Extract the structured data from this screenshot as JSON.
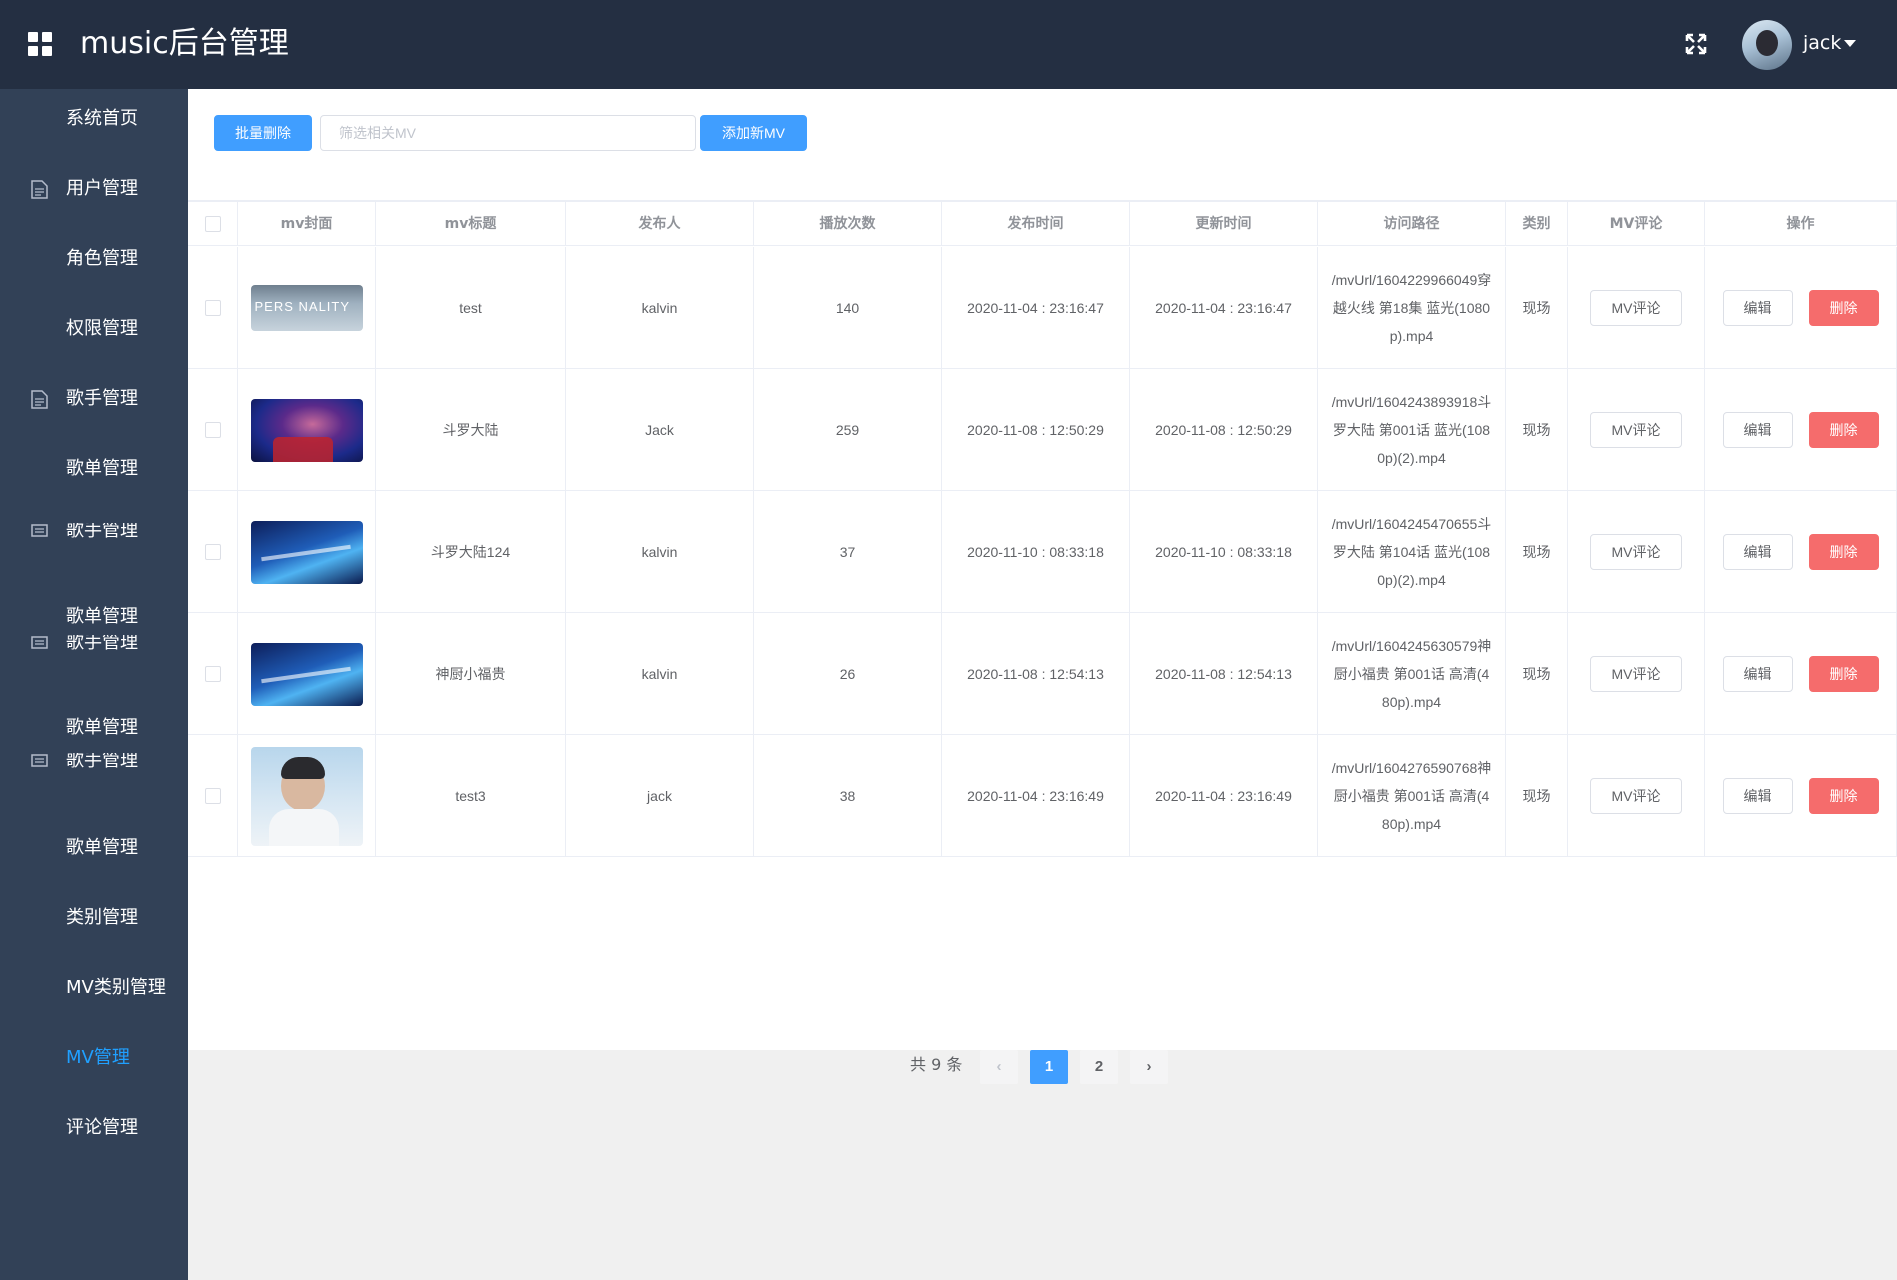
{
  "header": {
    "title": "music后台管理",
    "username": "jack"
  },
  "sidebar": {
    "items": [
      {
        "label": "系统首页",
        "icon": "none"
      },
      {
        "label": "用户管理",
        "icon": "document-icon"
      },
      {
        "label": "角色管理",
        "icon": "none"
      },
      {
        "label": "权限管理",
        "icon": "none"
      },
      {
        "label": "歌手管理",
        "icon": "document-icon"
      },
      {
        "label": "歌单管理",
        "icon": "none"
      },
      {
        "label": "歌手管理",
        "icon": "list-icon"
      },
      {
        "label": "歌单管理",
        "icon": "none"
      },
      {
        "label": "歌手管理",
        "icon": "list-icon"
      },
      {
        "label": "歌单管理",
        "icon": "none"
      },
      {
        "label": "歌手管理",
        "icon": "list-icon"
      },
      {
        "label": "歌单管理",
        "icon": "none"
      },
      {
        "label": "类别管理",
        "icon": "none"
      },
      {
        "label": "MV类别管理",
        "icon": "none"
      },
      {
        "label": "MV管理",
        "icon": "none",
        "active": true
      },
      {
        "label": "评论管理",
        "icon": "none"
      }
    ]
  },
  "toolbar": {
    "batch_delete": "批量删除",
    "search_placeholder": "筛选相关MV",
    "add_mv": "添加新MV"
  },
  "table": {
    "headers": [
      "mv封面",
      "mv标题",
      "发布人",
      "播放次数",
      "发布时间",
      "更新时间",
      "访问路径",
      "类别",
      "MV评论",
      "操作"
    ],
    "rows": [
      {
        "title": "test",
        "publisher": "kalvin",
        "plays": "140",
        "published": "2020-11-04 : 23:16:47",
        "updated": "2020-11-04 : 23:16:47",
        "path": "/mvUrl/1604229966049穿越火线 第18集 蓝光(1080p).mp4",
        "category": "现场",
        "cover_text": "PERS NALITY"
      },
      {
        "title": "斗罗大陆",
        "publisher": "Jack",
        "plays": "259",
        "published": "2020-11-08 : 12:50:29",
        "updated": "2020-11-08 : 12:50:29",
        "path": "/mvUrl/1604243893918斗罗大陆 第001话 蓝光(1080p)(2).mp4",
        "category": "现场",
        "cover_text": ""
      },
      {
        "title": "斗罗大陆124",
        "publisher": "kalvin",
        "plays": "37",
        "published": "2020-11-10 : 08:33:18",
        "updated": "2020-11-10 : 08:33:18",
        "path": "/mvUrl/1604245470655斗罗大陆 第104话 蓝光(1080p)(2).mp4",
        "category": "现场",
        "cover_text": ""
      },
      {
        "title": "神厨小福贵",
        "publisher": "kalvin",
        "plays": "26",
        "published": "2020-11-08 : 12:54:13",
        "updated": "2020-11-08 : 12:54:13",
        "path": "/mvUrl/1604245630579神厨小福贵 第001话 高清(480p).mp4",
        "category": "现场",
        "cover_text": ""
      },
      {
        "title": "test3",
        "publisher": "jack",
        "plays": "38",
        "published": "2020-11-04 : 23:16:49",
        "updated": "2020-11-04 : 23:16:49",
        "path": "/mvUrl/1604276590768神厨小福贵 第001话 高清(480p).mp4",
        "category": "现场",
        "cover_text": ""
      }
    ],
    "comment_btn": "MV评论",
    "edit_btn": "编辑",
    "delete_btn": "删除"
  },
  "pagination": {
    "total_text": "共 9 条",
    "pages": [
      "1",
      "2"
    ],
    "current": "1",
    "prev_icon": "‹",
    "next_icon": "›"
  },
  "colors": {
    "header_bg": "#242f42",
    "sidebar_bg": "#324157",
    "primary": "#409eff",
    "danger": "#f56c6c",
    "active_nav": "#20a0ff"
  }
}
